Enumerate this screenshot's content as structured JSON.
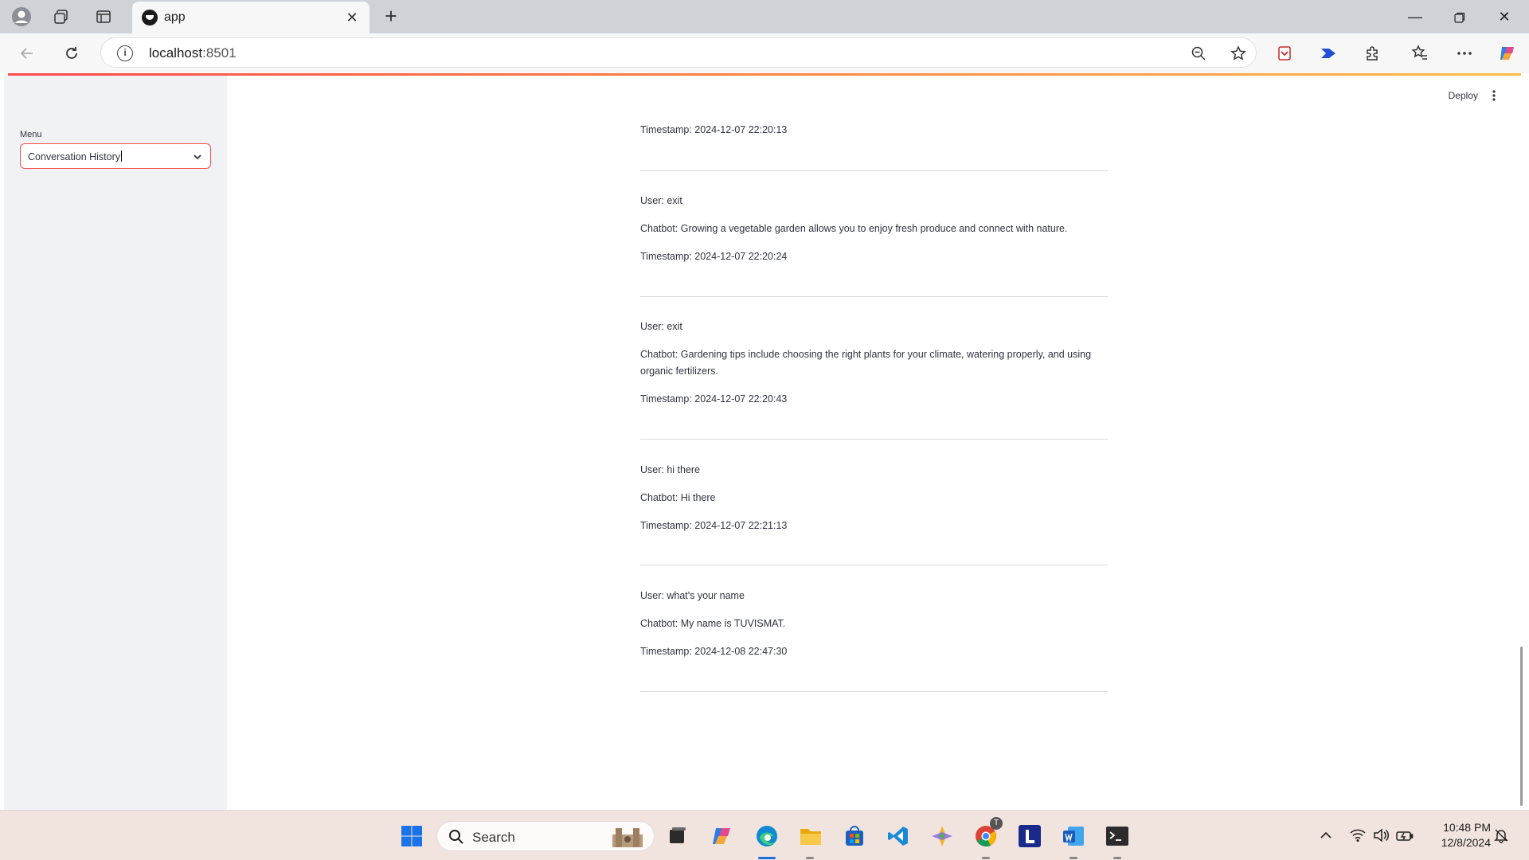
{
  "browser": {
    "tab_title": "app",
    "url_host": "localhost",
    "url_port": ":8501"
  },
  "sidebar": {
    "menu_label": "Menu",
    "menu_selected": "Conversation History"
  },
  "header": {
    "deploy_label": "Deploy"
  },
  "conversations": [
    {
      "timestamp": "Timestamp: 2024-12-07 22:20:13"
    },
    {
      "user": "User: exit",
      "bot": "Chatbot: Growing a vegetable garden allows you to enjoy fresh produce and connect with nature.",
      "timestamp": "Timestamp: 2024-12-07 22:20:24"
    },
    {
      "user": "User: exit",
      "bot": "Chatbot: Gardening tips include choosing the right plants for your climate, watering properly, and using organic fertilizers.",
      "timestamp": "Timestamp: 2024-12-07 22:20:43"
    },
    {
      "user": "User: hi there",
      "bot": "Chatbot: Hi there",
      "timestamp": "Timestamp: 2024-12-07 22:21:13"
    },
    {
      "user": "User: what's your name",
      "bot": "Chatbot: My name is TUVISMAT.",
      "timestamp": "Timestamp: 2024-12-08 22:47:30"
    }
  ],
  "taskbar": {
    "search_label": "Search",
    "chrome_badge": "T",
    "time": "10:48 PM",
    "date": "12/8/2024"
  },
  "colors": {
    "accent": "#ff4b4b",
    "sidebar_bg": "#f0f2f6",
    "text": "#31333f"
  }
}
